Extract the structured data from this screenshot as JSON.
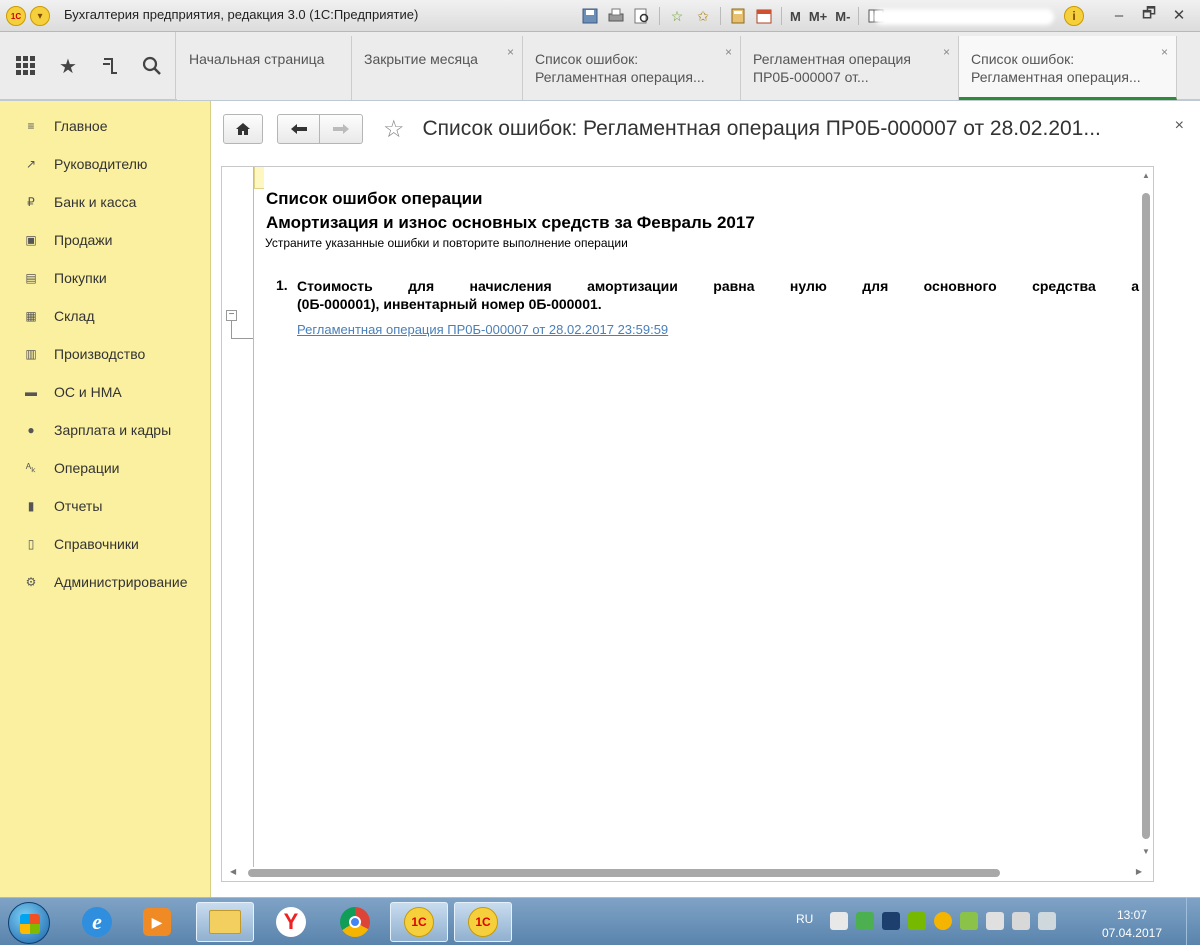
{
  "titlebar": {
    "logo": "1С",
    "title": "Бухгалтерия предприятия, редакция 3.0  (1С:Предприятие)",
    "tools": [
      "save-icon",
      "print-icon",
      "preview-icon",
      "add-favorite-icon",
      "favorites-icon",
      "calculator-icon",
      "calendar-icon"
    ],
    "mem": [
      "M",
      "M+",
      "M-"
    ],
    "info_icon": "i",
    "controls": [
      "‒",
      "🗗",
      "✕"
    ]
  },
  "tabs": [
    {
      "label": "Начальная страница",
      "closable": false
    },
    {
      "label": "Закрытие месяца",
      "closable": true
    },
    {
      "label": "Список ошибок: Регламентная операция...",
      "closable": true
    },
    {
      "label": "Регламентная операция ПР0Б-000007 от...",
      "closable": true
    },
    {
      "label": "Список ошибок: Регламентная операция...",
      "closable": true,
      "active": true
    }
  ],
  "sidebar": {
    "items": [
      {
        "label": "Главное",
        "icon": "≡"
      },
      {
        "label": "Руководителю",
        "icon": "↗"
      },
      {
        "label": "Банк и касса",
        "icon": "₽"
      },
      {
        "label": "Продажи",
        "icon": "▣"
      },
      {
        "label": "Покупки",
        "icon": "▤"
      },
      {
        "label": "Склад",
        "icon": "▦"
      },
      {
        "label": "Производство",
        "icon": "▥"
      },
      {
        "label": "ОС и НМА",
        "icon": "▬"
      },
      {
        "label": "Зарплата и кадры",
        "icon": "●"
      },
      {
        "label": "Операции",
        "icon": "ᴬₖ"
      },
      {
        "label": "Отчеты",
        "icon": "▮"
      },
      {
        "label": "Справочники",
        "icon": "▯"
      },
      {
        "label": "Администрирование",
        "icon": "⚙"
      }
    ]
  },
  "content": {
    "title": "Список ошибок: Регламентная операция ПР0Б-000007 от 28.02.201...",
    "close": "×",
    "heading": "Список ошибок операции",
    "subheading": "Амортизация и износ основных средств за Февраль 2017",
    "hint": "Устраните указанные ошибки и повторите выполнение операции",
    "error": {
      "number": "1.",
      "line1": "Стоимость для начисления амортизации равна нулю для основного средства                  а",
      "line2": "(0Б-000001), инвентарный номер 0Б-000001.",
      "link": "Регламентная операция ПР0Б-000007 от 28.02.2017 23:59:59"
    }
  },
  "taskbar": {
    "lang": "RU",
    "time": "13:07",
    "date": "07.04.2017",
    "apps": [
      "ie",
      "media",
      "explorer",
      "yandex",
      "chrome",
      "1c",
      "1c-active"
    ]
  },
  "colors": {
    "sidebar_bg": "#faf0a0",
    "active_tab_accent": "#2f8a3a",
    "link": "#4a7fb8"
  }
}
